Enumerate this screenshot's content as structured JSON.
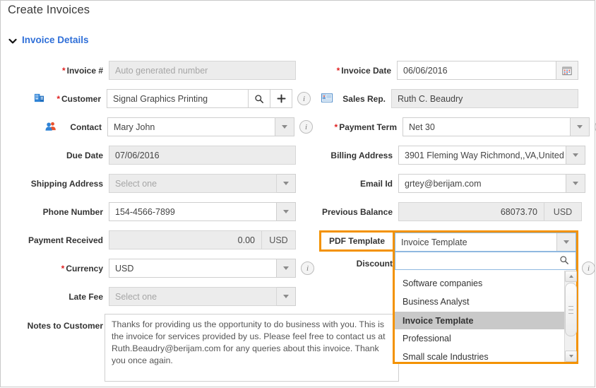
{
  "page": {
    "title": "Create Invoices",
    "section_label": "Invoice Details",
    "collapse_icon": "chevron-down-icon"
  },
  "left_fields": [
    {
      "key": "invoice_number",
      "label": "Invoice #",
      "required": true,
      "icon": null,
      "value": "",
      "placeholder": "Auto generated number",
      "state": "disabled",
      "control": "text"
    },
    {
      "key": "customer",
      "label": "Customer",
      "required": true,
      "icon": "building-icon",
      "value": "Signal Graphics Printing",
      "placeholder": "",
      "state": "enabled",
      "control": "lookup",
      "buttons": [
        "search-icon",
        "plus-icon"
      ],
      "info": true
    },
    {
      "key": "contact",
      "label": "Contact",
      "required": false,
      "icon": "contacts-icon",
      "value": "Mary John",
      "placeholder": "",
      "state": "enabled",
      "control": "select",
      "info": true
    },
    {
      "key": "due_date",
      "label": "Due Date",
      "required": false,
      "icon": null,
      "value": "07/06/2016",
      "placeholder": "",
      "state": "disabled",
      "control": "text"
    },
    {
      "key": "shipping_address",
      "label": "Shipping Address",
      "required": false,
      "icon": null,
      "value": "",
      "placeholder": "Select one",
      "state": "disabled",
      "control": "select"
    },
    {
      "key": "phone_number",
      "label": "Phone Number",
      "required": false,
      "icon": null,
      "value": "154-4566-7899",
      "placeholder": "",
      "state": "enabled",
      "control": "select"
    },
    {
      "key": "payment_received",
      "label": "Payment Received",
      "required": false,
      "icon": null,
      "value": "0.00",
      "placeholder": "",
      "state": "disabled",
      "control": "amount",
      "unit": "USD"
    },
    {
      "key": "currency",
      "label": "Currency",
      "required": true,
      "icon": null,
      "value": "USD",
      "placeholder": "",
      "state": "enabled",
      "control": "select",
      "info": true
    },
    {
      "key": "late_fee",
      "label": "Late Fee",
      "required": false,
      "icon": null,
      "value": "",
      "placeholder": "Select one",
      "state": "disabled",
      "control": "select"
    }
  ],
  "right_fields": [
    {
      "key": "invoice_date",
      "label": "Invoice Date",
      "required": true,
      "icon": null,
      "value": "06/06/2016",
      "placeholder": "",
      "state": "enabled",
      "control": "date",
      "button": "calendar-icon"
    },
    {
      "key": "sales_rep",
      "label": "Sales Rep.",
      "required": false,
      "icon": "id-card-icon",
      "value": "Ruth C. Beaudry",
      "placeholder": "",
      "state": "disabled",
      "control": "text"
    },
    {
      "key": "payment_term",
      "label": "Payment Term",
      "required": true,
      "icon": null,
      "value": "Net 30",
      "placeholder": "",
      "state": "enabled",
      "control": "select",
      "info": true
    },
    {
      "key": "billing_address",
      "label": "Billing Address",
      "required": false,
      "icon": null,
      "value": "3901 Fleming Way Richmond,,VA,United S",
      "placeholder": "",
      "state": "enabled",
      "control": "select"
    },
    {
      "key": "email_id",
      "label": "Email Id",
      "required": false,
      "icon": null,
      "value": "grtey@berijam.com",
      "placeholder": "",
      "state": "enabled",
      "control": "select"
    },
    {
      "key": "previous_balance",
      "label": "Previous Balance",
      "required": false,
      "icon": null,
      "value": "68073.70",
      "placeholder": "",
      "state": "disabled",
      "control": "amount",
      "unit": "USD"
    }
  ],
  "pdf_template": {
    "label": "PDF Template",
    "selected": "Invoice Template",
    "search_value": "",
    "search_icon": "search-icon",
    "caret_icon": "caret-down-icon",
    "options": [
      "Software companies",
      "Business Analyst",
      "Invoice Template",
      "Professional",
      "Small scale Industries"
    ],
    "selected_index": 2,
    "highlight_color": "#f39200"
  },
  "discount": {
    "label": "Discount",
    "info": true
  },
  "notes": {
    "label": "Notes to Customer",
    "value": "Thanks for providing us the opportunity to do business with you. This is the invoice for services provided by us. Please feel free to contact us at Ruth.Beaudry@berijam.com for any queries about this invoice. Thank you once again."
  }
}
